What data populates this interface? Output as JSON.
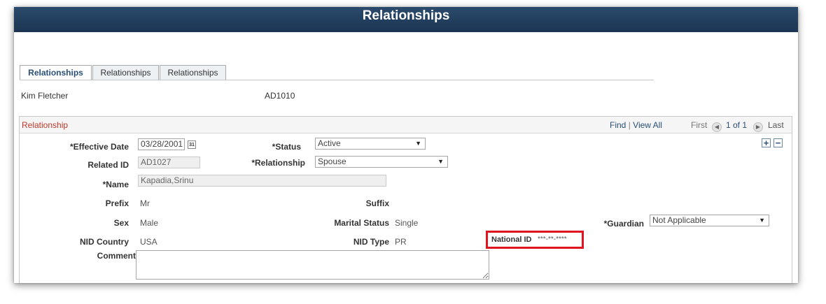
{
  "page": {
    "title": "Relationships"
  },
  "tabs": [
    {
      "label": "Relationships",
      "active": true
    },
    {
      "label": "Relationships",
      "active": false
    },
    {
      "label": "Relationships",
      "active": false
    }
  ],
  "employee": {
    "name": "Kim Fletcher",
    "id": "AD1010"
  },
  "grid": {
    "title": "Relationship",
    "find": "Find",
    "separator": "|",
    "view_all": "View All",
    "first": "First",
    "counter": "1 of 1",
    "last": "Last",
    "add_label": "+",
    "remove_label": "−"
  },
  "form": {
    "effective_date": {
      "label": "*Effective Date",
      "value": "03/28/2001",
      "calendar_glyph": "31"
    },
    "status": {
      "label": "*Status",
      "value": "Active"
    },
    "related_id": {
      "label": "Related ID",
      "value": "AD1027"
    },
    "relationship": {
      "label": "*Relationship",
      "value": "Spouse"
    },
    "name": {
      "label": "*Name",
      "value": "Kapadia,Srinu"
    },
    "prefix": {
      "label": "Prefix",
      "value": "Mr"
    },
    "suffix": {
      "label": "Suffix",
      "value": ""
    },
    "sex": {
      "label": "Sex",
      "value": "Male"
    },
    "marital_status": {
      "label": "Marital Status",
      "value": "Single"
    },
    "guardian": {
      "label": "*Guardian",
      "value": "Not Applicable"
    },
    "nid_country": {
      "label": "NID Country",
      "value": "USA"
    },
    "nid_type": {
      "label": "NID Type",
      "value": "PR"
    },
    "national_id": {
      "label": "National ID",
      "value": "***-**-****"
    },
    "comment": {
      "label": "Comment",
      "value": ""
    }
  },
  "colors": {
    "banner": "#1c3552",
    "highlight": "#e0141e",
    "link": "#2a4f78",
    "grid_title": "#c0392b"
  }
}
